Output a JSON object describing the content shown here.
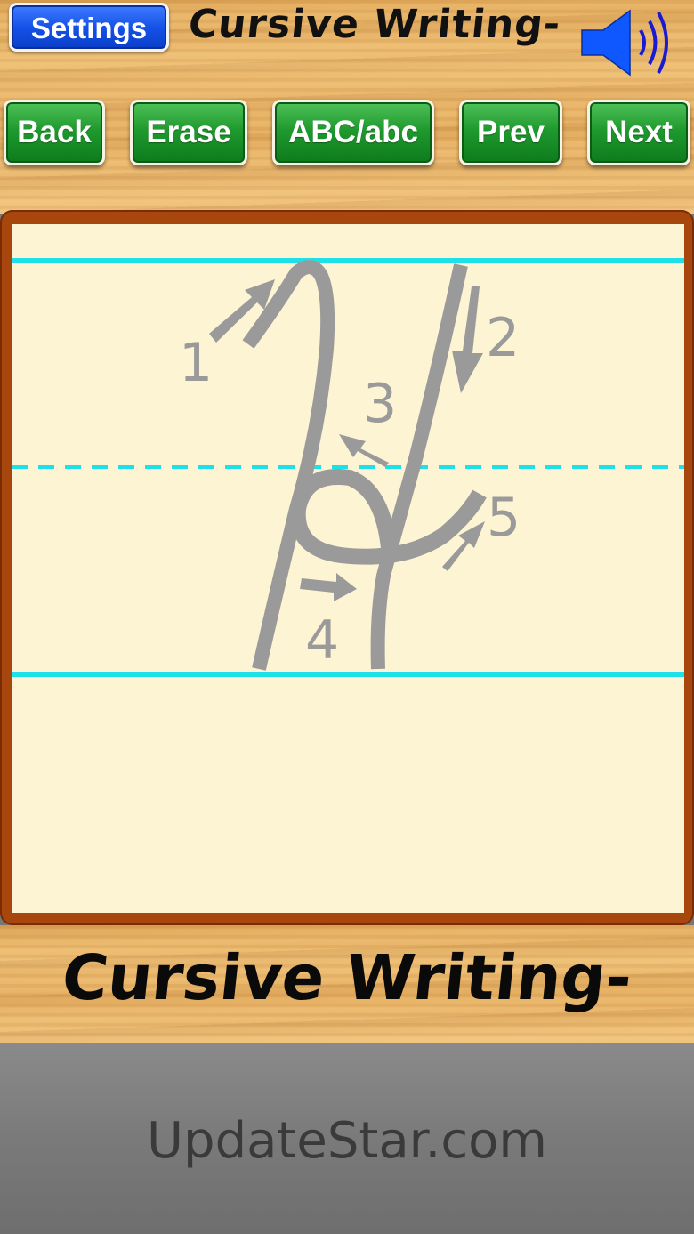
{
  "header": {
    "settings_label": "Settings",
    "title": "Cursive Writing-",
    "sound_icon": "speaker-icon"
  },
  "toolbar": {
    "back_label": "Back",
    "erase_label": "Erase",
    "case_label": "ABC/abc",
    "prev_label": "Prev",
    "next_label": "Next"
  },
  "practice": {
    "letter": "H",
    "stroke_numbers": [
      "1",
      "2",
      "3",
      "4",
      "5"
    ],
    "guide_line_color": "#1de0ea",
    "stroke_color": "#9a9a9a"
  },
  "footer": {
    "title": "Cursive Writing-"
  },
  "ad": {
    "watermark": "UpdateStar.com"
  },
  "colors": {
    "settings_button": "#1552e8",
    "nav_button": "#1f9a2e",
    "board_frame": "#a7460d",
    "paper": "#fdf4d3"
  }
}
